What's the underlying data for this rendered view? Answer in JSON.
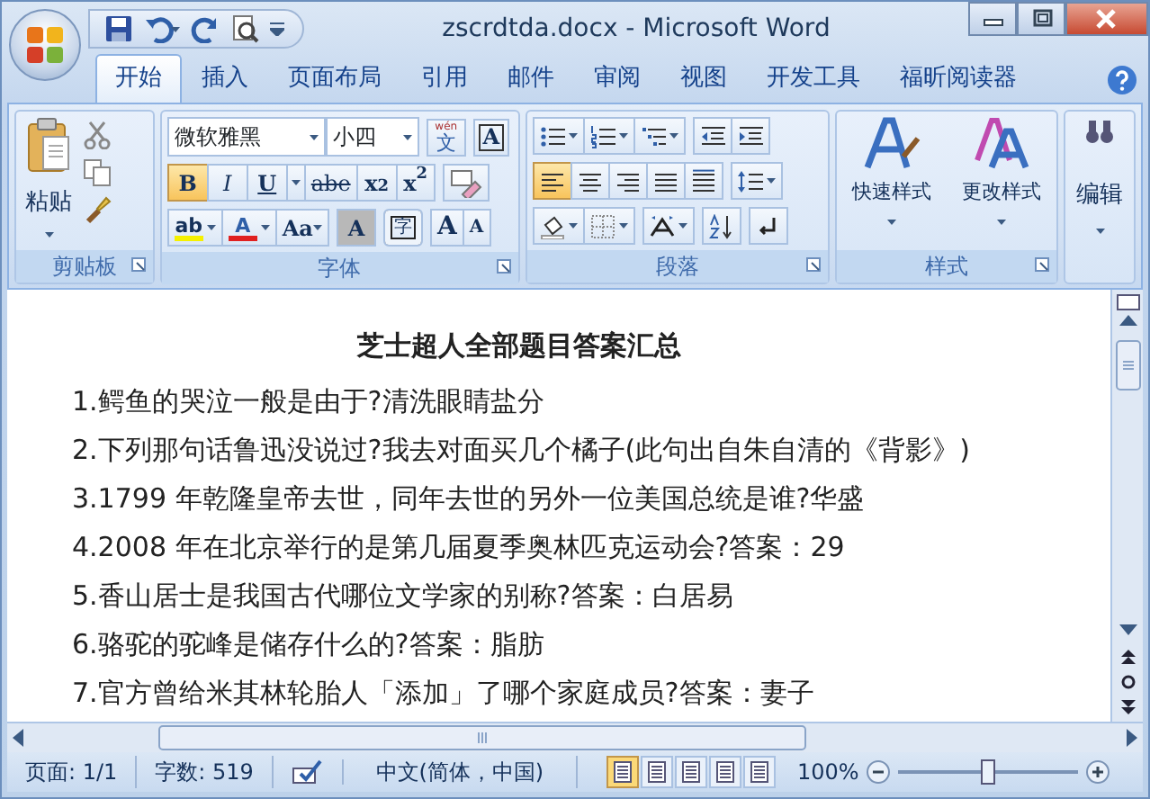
{
  "window": {
    "title": "zscrdtda.docx - Microsoft Word"
  },
  "tabs": [
    {
      "label": "开始",
      "selected": true
    },
    {
      "label": "插入",
      "selected": false
    },
    {
      "label": "页面布局",
      "selected": false
    },
    {
      "label": "引用",
      "selected": false
    },
    {
      "label": "邮件",
      "selected": false
    },
    {
      "label": "审阅",
      "selected": false
    },
    {
      "label": "视图",
      "selected": false
    },
    {
      "label": "开发工具",
      "selected": false
    },
    {
      "label": "福昕阅读器",
      "selected": false
    }
  ],
  "ribbon": {
    "clipboard": {
      "label": "剪贴板",
      "paste": "粘贴"
    },
    "font": {
      "label": "字体",
      "font_name": "微软雅黑",
      "font_size": "小四",
      "phonetic_top": "wén",
      "phonetic_char": "文",
      "border_char": "A",
      "format_buttons": [
        {
          "glyph": "B",
          "on": true,
          "kind": "bold"
        },
        {
          "glyph": "I",
          "on": false,
          "kind": "italic"
        },
        {
          "glyph": "U",
          "on": false,
          "kind": "underline"
        },
        {
          "glyph": "abe",
          "on": false,
          "kind": "strike"
        },
        {
          "glyph": "x$_{2}$",
          "on": false,
          "kind": "subscript"
        },
        {
          "glyph": "x$^{2}$",
          "on": false,
          "kind": "superscript"
        }
      ],
      "highlight_glyph": "ab",
      "color_glyph": "A",
      "case_glyph": "Aa",
      "shade_glyph": "A",
      "enclose_glyph": "字",
      "grow_glyph": "A",
      "shrink_glyph": "A"
    },
    "paragraph": {
      "label": "段落",
      "alignments": [
        {
          "kind": "left",
          "selected": true
        },
        {
          "kind": "center",
          "selected": false
        },
        {
          "kind": "right",
          "selected": false
        },
        {
          "kind": "justify",
          "selected": false
        },
        {
          "kind": "distributed",
          "selected": false
        }
      ]
    },
    "styles": {
      "label": "样式",
      "buttons": [
        "快速样式",
        "更改样式"
      ]
    },
    "editing": {
      "label": "编辑"
    }
  },
  "document": {
    "title": "芝士超人全部题目答案汇总",
    "lines": [
      "1.鳄鱼的哭泣一般是由于?清洗眼睛盐分",
      "2.下列那句话鲁迅没说过?我去对面买几个橘子(此句出自朱自清的《背影》)",
      "3.1799 年乾隆皇帝去世，同年去世的另外一位美国总统是谁?华盛",
      "4.2008 年在北京举行的是第几届夏季奥林匹克运动会?答案：29",
      "5.香山居士是我国古代哪位文学家的别称?答案：白居易",
      "6.骆驼的驼峰是储存什么的?答案：脂肪",
      "7.官方曾给米其林轮胎人「添加」了哪个家庭成员?答案：妻子"
    ]
  },
  "status_bar": {
    "page": "页面: 1/1",
    "words": "字数: 519",
    "language": "中文(简体，中国)",
    "views": [
      {
        "selected": true
      },
      {
        "selected": false
      },
      {
        "selected": false
      },
      {
        "selected": false
      },
      {
        "selected": false
      }
    ],
    "zoom": "100%",
    "zoom_slider": {
      "level": 0.5
    }
  }
}
